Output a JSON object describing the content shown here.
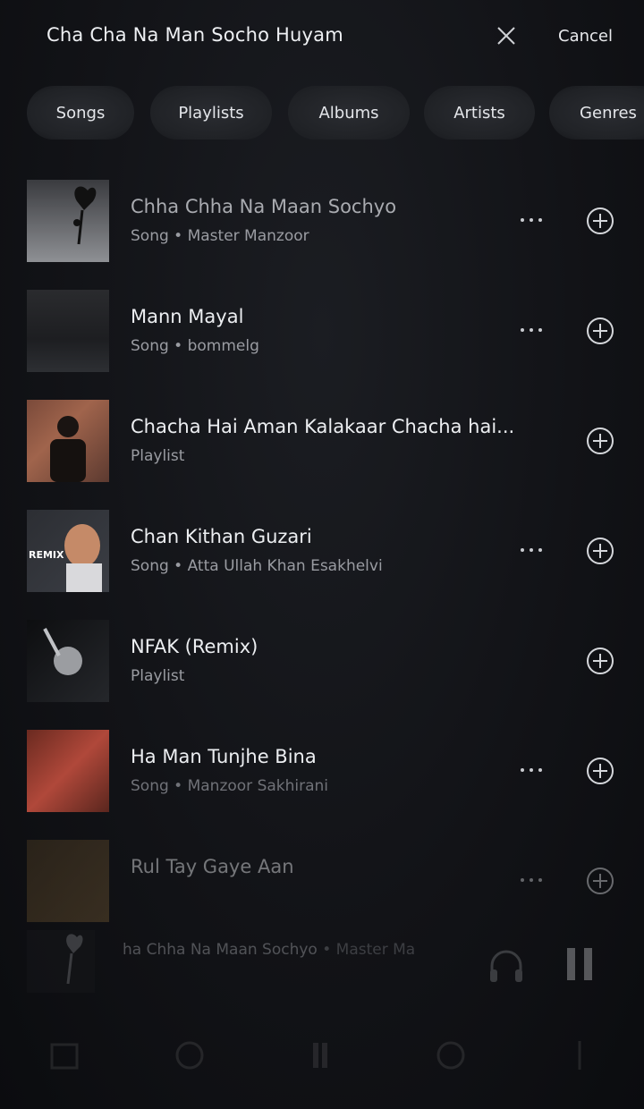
{
  "search": {
    "query": "Cha Cha Na Man Socho Huyam",
    "cancel_label": "Cancel"
  },
  "filters": [
    "Songs",
    "Playlists",
    "Albums",
    "Artists",
    "Genres"
  ],
  "results": [
    {
      "title": "Chha Chha Na Maan Sochyo",
      "subtitle": "Song • Master Manzoor",
      "has_more": true
    },
    {
      "title": "Mann Mayal",
      "subtitle": "Song • bommelg",
      "has_more": true
    },
    {
      "title": "Chacha Hai Aman Kalakaar Chacha hai...",
      "subtitle": "Playlist",
      "has_more": false
    },
    {
      "title": "Chan Kithan Guzari",
      "subtitle": "Song • Atta Ullah Khan Esakhelvi",
      "has_more": true
    },
    {
      "title": "NFAK (Remix)",
      "subtitle": "Playlist",
      "has_more": false
    },
    {
      "title": "Ha Man Tunjhe Bina",
      "subtitle": "Song • Manzoor Sakhirani",
      "has_more": true
    },
    {
      "title": "Rul Tay Gaye Aan",
      "subtitle": "",
      "has_more": true
    }
  ],
  "thumbnails": {
    "row4_badge": "REMIX"
  },
  "mini_player": {
    "title": "ha Chha Na Maan Sochyo",
    "artist": " • Master Ma"
  },
  "icons": {
    "clear": "close-icon",
    "more": "more-dots-icon",
    "add": "plus-circle-icon",
    "headphones": "headphones-icon",
    "pause": "pause-icon"
  },
  "colors": {
    "background": "#121317",
    "text": "#eceef1",
    "subtext": "#9a9ca2",
    "chip": "#222428"
  }
}
